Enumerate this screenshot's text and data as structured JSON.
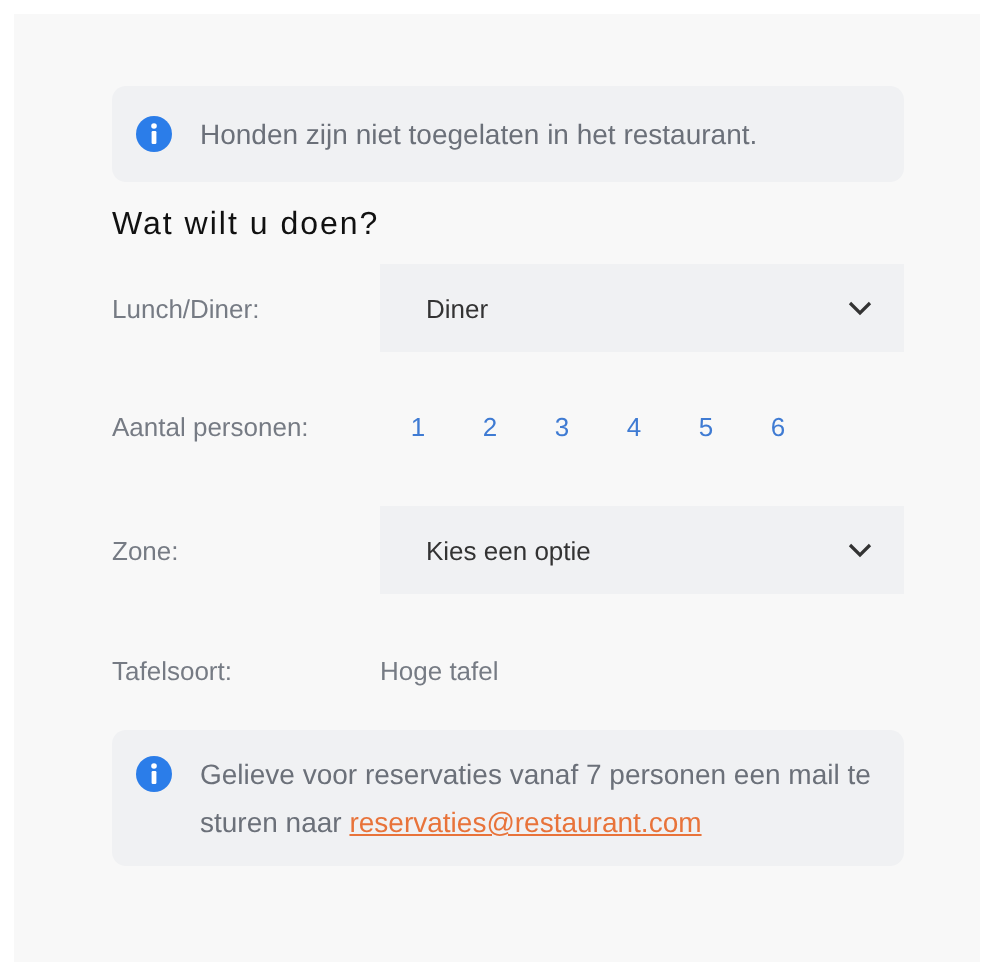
{
  "notice": {
    "text": "Honden zijn niet toegelaten in het restaurant."
  },
  "heading": "Wat wilt u doen?",
  "fields": [
    {
      "kind": "select",
      "label": "Lunch/Diner:",
      "value": "Diner"
    },
    {
      "kind": "numbers",
      "label": "Aantal personen:",
      "options": [
        "1",
        "2",
        "3",
        "4",
        "5",
        "6"
      ]
    },
    {
      "kind": "select",
      "label": "Zone:",
      "value": "Kies een optie"
    },
    {
      "kind": "text",
      "label": "Tafelsoort:",
      "value": "Hoge tafel"
    }
  ],
  "info": {
    "text": "Gelieve voor reservaties vanaf 7 personen een mail te sturen naar",
    "link": "reservaties@restaurant.com"
  }
}
